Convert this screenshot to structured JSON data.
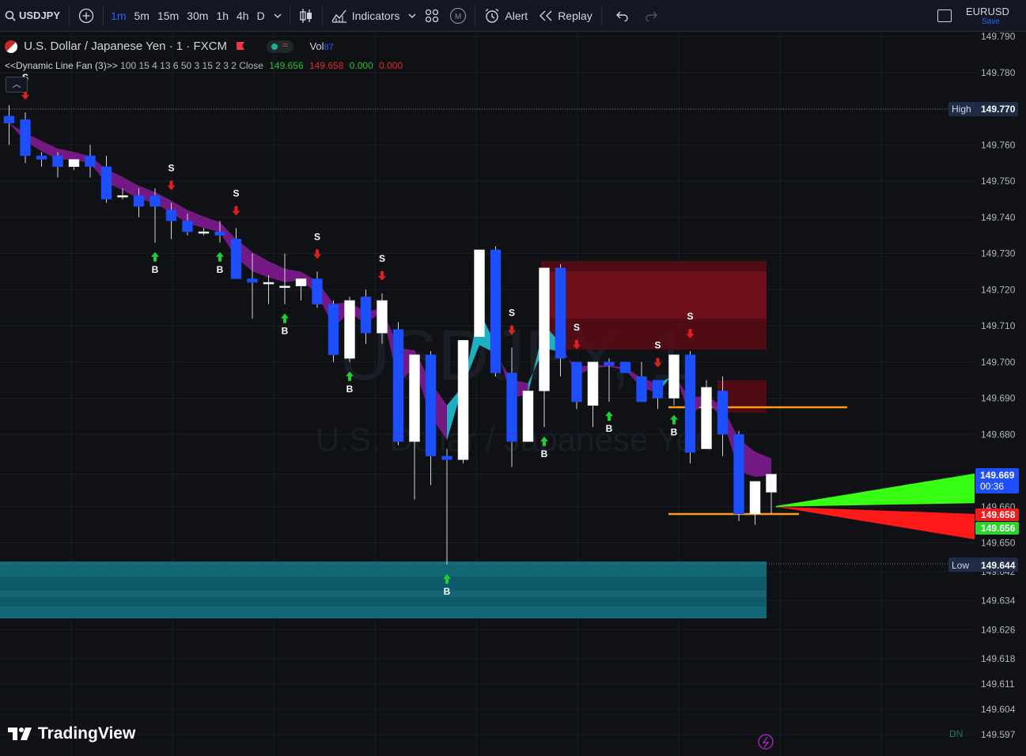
{
  "toolbar": {
    "symbol": "USDJPY",
    "intervals": [
      "1m",
      "5m",
      "15m",
      "30m",
      "1h",
      "4h",
      "D"
    ],
    "active_interval": "1m",
    "indicators_label": "Indicators",
    "alert_label": "Alert",
    "replay_label": "Replay",
    "layout_name": "EURUSD",
    "save_label": "Save"
  },
  "legend": {
    "title": "U.S. Dollar / Japanese Yen · 1 · FXCM",
    "vol_label": "Vol",
    "vol_value": "87",
    "indicator_name": "<<Dynamic Line Fan (3)>>",
    "indicator_params": "100 15 4 13 6 50 3 15 2 3 2 Close",
    "v1": "149.656",
    "v2": "149.658",
    "v3": "0.000",
    "v4": "0.000"
  },
  "watermark": {
    "symbol": "USDJPY, 1",
    "name": "U.S. Dollar / Japanese Yen"
  },
  "price_axis": {
    "labels": [
      "149.790",
      "149.780",
      "149.770",
      "149.760",
      "149.750",
      "149.740",
      "149.730",
      "149.720",
      "149.710",
      "149.700",
      "149.690",
      "149.680",
      "149.669",
      "149.660",
      "149.650",
      "149.642",
      "149.634",
      "149.626",
      "149.618",
      "149.611",
      "149.604",
      "149.597"
    ],
    "high_label": "High",
    "high_value": "149.770",
    "low_label": "Low",
    "low_value": "149.644",
    "last_price": "149.669",
    "countdown": "00:36",
    "red_value": "149.658",
    "green_value": "149.656",
    "dn_label": "DN"
  },
  "signals": {
    "buy": "B",
    "sell": "S"
  },
  "brand": "TradingView",
  "colors": {
    "bull": "#ffffff",
    "bear": "#1e4fff",
    "accent": "#2962ff",
    "buy_arrow": "#22cc33",
    "sell_arrow": "#e0201c",
    "fan_green": "#39ff14",
    "fan_red": "#ff1a1a",
    "band_cyan": "#1eb8c8",
    "band_purple": "#7a1a8a"
  },
  "chart_data": {
    "type": "candlestick",
    "symbol": "USDJPY",
    "ylim": [
      149.597,
      149.79
    ],
    "candles": [
      {
        "o": 149.768,
        "h": 149.771,
        "c": 149.766,
        "l": 149.76
      },
      {
        "o": 149.767,
        "h": 149.769,
        "c": 149.757,
        "l": 149.755
      },
      {
        "o": 149.757,
        "h": 149.758,
        "c": 149.756,
        "l": 149.754
      },
      {
        "o": 149.757,
        "h": 149.758,
        "c": 149.754,
        "l": 149.751
      },
      {
        "o": 149.754,
        "h": 149.756,
        "c": 149.756,
        "l": 149.753
      },
      {
        "o": 149.757,
        "h": 149.76,
        "c": 149.754,
        "l": 149.751
      },
      {
        "o": 149.754,
        "h": 149.757,
        "c": 149.745,
        "l": 149.744
      },
      {
        "o": 149.746,
        "h": 149.748,
        "c": 149.746,
        "l": 149.745
      },
      {
        "o": 149.746,
        "h": 149.748,
        "c": 149.743,
        "l": 149.74
      },
      {
        "o": 149.746,
        "h": 149.748,
        "c": 149.743,
        "l": 149.733
      },
      {
        "o": 149.742,
        "h": 149.744,
        "c": 149.739,
        "l": 149.734
      },
      {
        "o": 149.739,
        "h": 149.741,
        "c": 149.736,
        "l": 149.735
      },
      {
        "o": 149.736,
        "h": 149.737,
        "c": 149.736,
        "l": 149.735
      },
      {
        "o": 149.736,
        "h": 149.739,
        "c": 149.735,
        "l": 149.733
      },
      {
        "o": 149.734,
        "h": 149.737,
        "c": 149.723,
        "l": 149.723
      },
      {
        "o": 149.723,
        "h": 149.73,
        "c": 149.722,
        "l": 149.712
      },
      {
        "o": 149.722,
        "h": 149.724,
        "c": 149.722,
        "l": 149.716
      },
      {
        "o": 149.721,
        "h": 149.73,
        "c": 149.721,
        "l": 149.716
      },
      {
        "o": 149.721,
        "h": 149.723,
        "c": 149.723,
        "l": 149.717
      },
      {
        "o": 149.723,
        "h": 149.725,
        "c": 149.716,
        "l": 149.715
      },
      {
        "o": 149.716,
        "h": 149.717,
        "c": 149.702,
        "l": 149.7
      },
      {
        "o": 149.701,
        "h": 149.718,
        "c": 149.717,
        "l": 149.7
      },
      {
        "o": 149.718,
        "h": 149.72,
        "c": 149.708,
        "l": 149.705
      },
      {
        "o": 149.708,
        "h": 149.719,
        "c": 149.717,
        "l": 149.705
      },
      {
        "o": 149.709,
        "h": 149.711,
        "c": 149.678,
        "l": 149.677
      },
      {
        "o": 149.678,
        "h": 149.702,
        "c": 149.702,
        "l": 149.662
      },
      {
        "o": 149.702,
        "h": 149.703,
        "c": 149.674,
        "l": 149.666
      },
      {
        "o": 149.674,
        "h": 149.676,
        "c": 149.673,
        "l": 149.644
      },
      {
        "o": 149.673,
        "h": 149.706,
        "c": 149.706,
        "l": 149.672
      },
      {
        "o": 149.707,
        "h": 149.731,
        "c": 149.731,
        "l": 149.707
      },
      {
        "o": 149.731,
        "h": 149.732,
        "c": 149.697,
        "l": 149.696
      },
      {
        "o": 149.697,
        "h": 149.704,
        "c": 149.678,
        "l": 149.671
      },
      {
        "o": 149.678,
        "h": 149.69,
        "c": 149.692,
        "l": 149.678
      },
      {
        "o": 149.692,
        "h": 149.726,
        "c": 149.726,
        "l": 149.682
      },
      {
        "o": 149.726,
        "h": 149.727,
        "c": 149.701,
        "l": 149.696
      },
      {
        "o": 149.7,
        "h": 149.7,
        "c": 149.689,
        "l": 149.687
      },
      {
        "o": 149.688,
        "h": 149.7,
        "c": 149.7,
        "l": 149.682
      },
      {
        "o": 149.7,
        "h": 149.701,
        "c": 149.699,
        "l": 149.689
      },
      {
        "o": 149.7,
        "h": 149.7,
        "c": 149.697,
        "l": 149.697
      },
      {
        "o": 149.696,
        "h": 149.7,
        "c": 149.689,
        "l": 149.689
      },
      {
        "o": 149.695,
        "h": 149.695,
        "c": 149.69,
        "l": 149.687
      },
      {
        "o": 149.69,
        "h": 149.702,
        "c": 149.702,
        "l": 149.688
      },
      {
        "o": 149.702,
        "h": 149.703,
        "c": 149.675,
        "l": 149.672
      },
      {
        "o": 149.676,
        "h": 149.695,
        "c": 149.693,
        "l": 149.676
      },
      {
        "o": 149.692,
        "h": 149.696,
        "c": 149.68,
        "l": 149.674
      },
      {
        "o": 149.68,
        "h": 149.681,
        "c": 149.658,
        "l": 149.656
      },
      {
        "o": 149.658,
        "h": 149.663,
        "c": 149.667,
        "l": 149.655
      },
      {
        "o": 149.664,
        "h": 149.667,
        "c": 149.669,
        "l": 149.658
      }
    ]
  }
}
